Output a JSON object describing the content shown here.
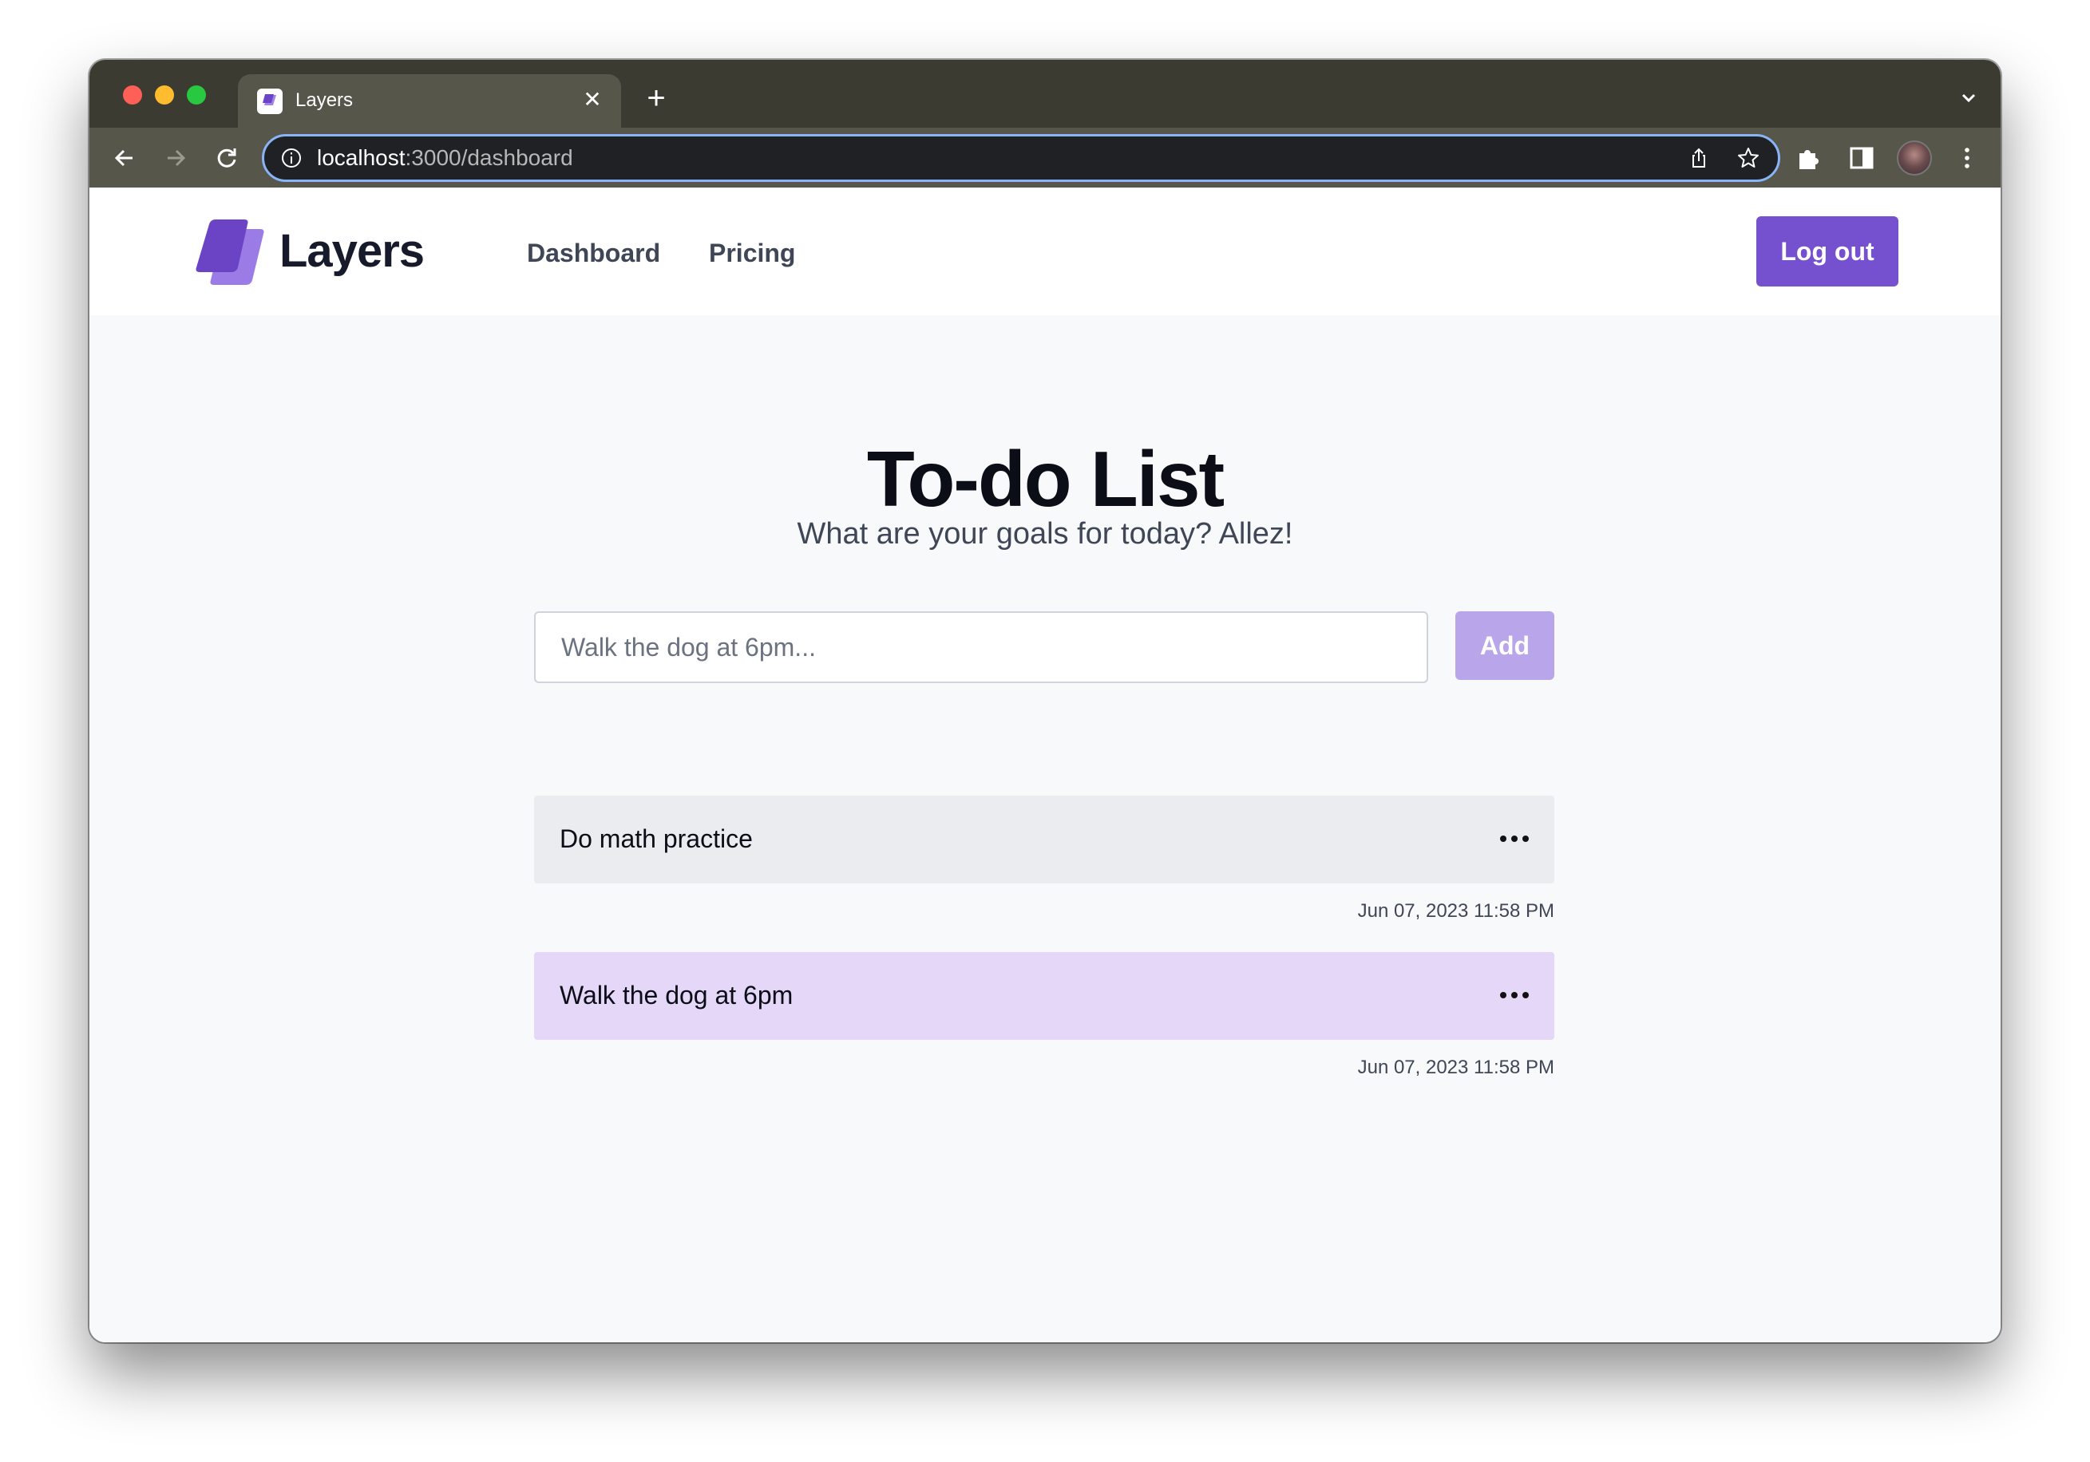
{
  "browser": {
    "tab_title": "Layers",
    "url_host": "localhost",
    "url_rest": ":3000/dashboard"
  },
  "navbar": {
    "brand": "Layers",
    "links": [
      "Dashboard",
      "Pricing"
    ],
    "logout_label": "Log out"
  },
  "main": {
    "title": "To-do List",
    "subtitle": "What are your goals for today? Allez!",
    "input_placeholder": "Walk the dog at 6pm...",
    "add_label": "Add",
    "todos": [
      {
        "text": "Do math practice",
        "date": "Jun 07, 2023 11:58 PM"
      },
      {
        "text": "Walk the dog at 6pm",
        "date": "Jun 07, 2023 11:58 PM"
      }
    ]
  },
  "colors": {
    "brand_purple": "#7550cf",
    "add_button_disabled": "#b9a6ea",
    "todo_default_bg": "#eaecef",
    "todo_highlight_bg": "#e5d7f8"
  }
}
